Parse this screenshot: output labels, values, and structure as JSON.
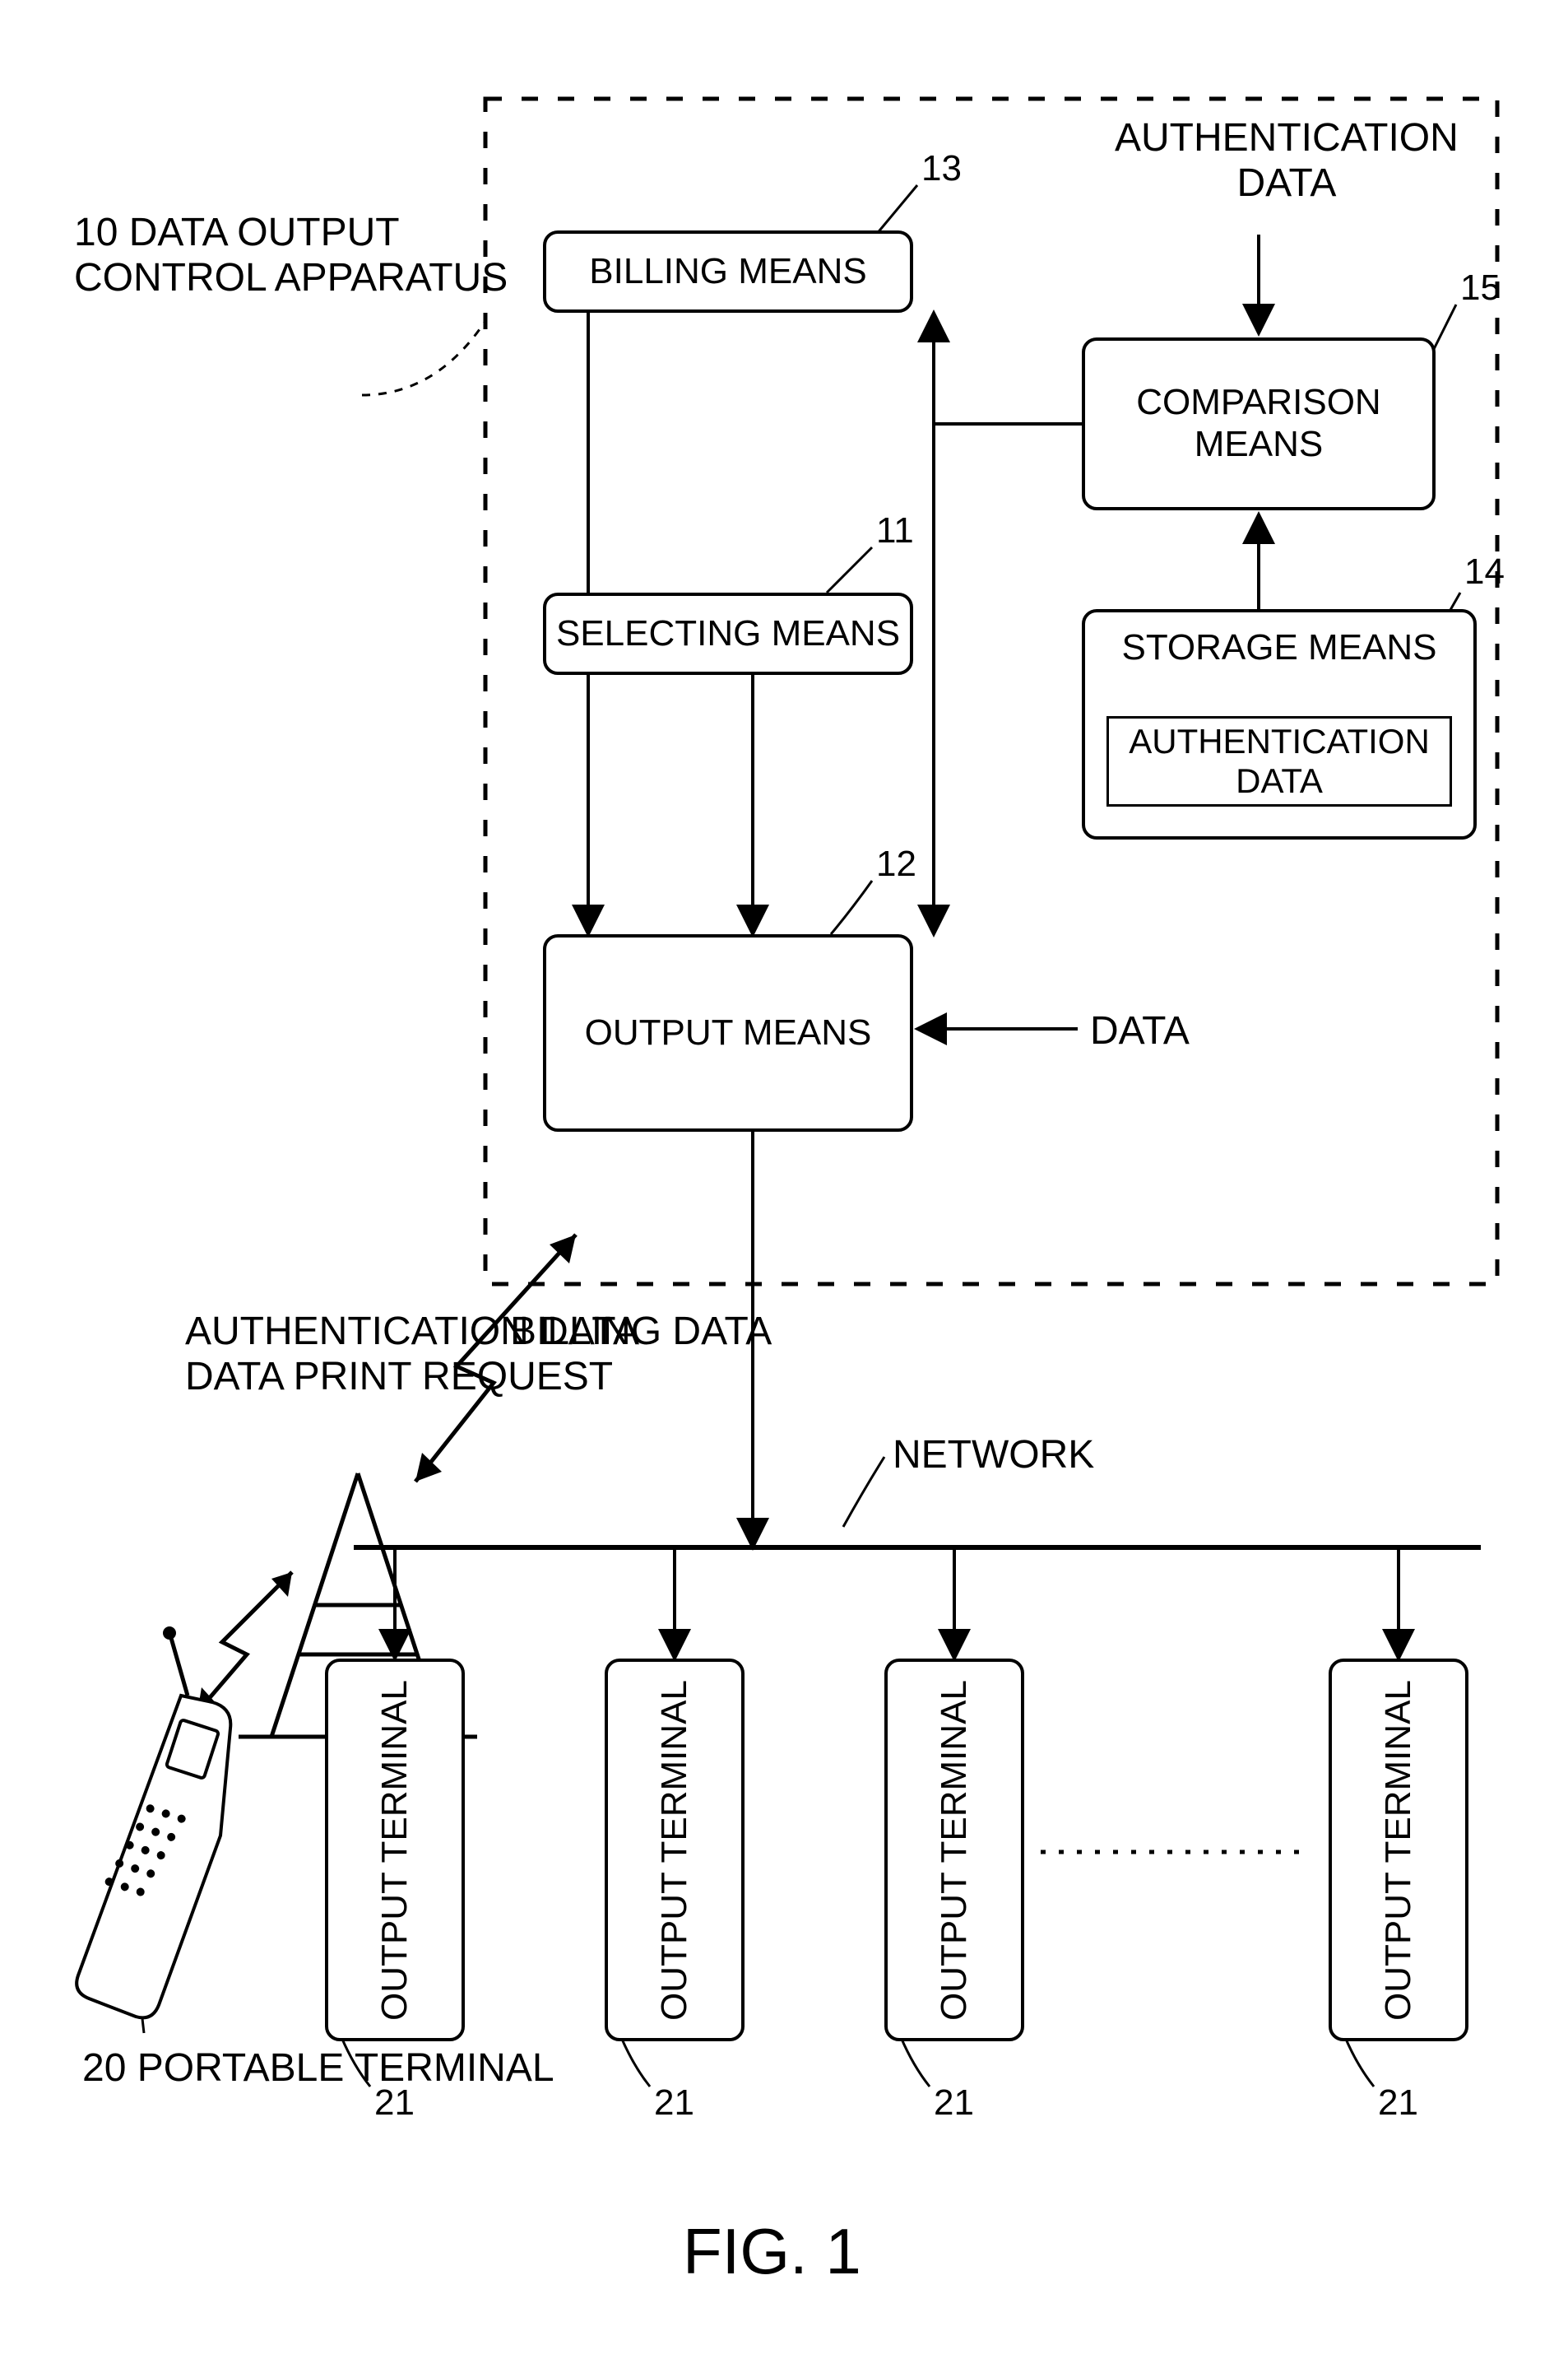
{
  "title": "10 DATA OUTPUT\nCONTROL APPARATUS",
  "boxes": {
    "billing": "BILLING MEANS",
    "selecting": "SELECTING MEANS",
    "output": "OUTPUT MEANS",
    "comparison": "COMPARISON\nMEANS",
    "storage": "STORAGE MEANS",
    "auth_inner": "AUTHENTICATION DATA",
    "ot": "OUTPUT TERMINAL"
  },
  "refs": {
    "r11": "11",
    "r12": "12",
    "r13": "13",
    "r14": "14",
    "r15": "15",
    "r20": "20",
    "r21": "21"
  },
  "labels": {
    "auth_data_top": "AUTHENTICATION\nDATA",
    "data": "DATA",
    "billing_data": "BILLING DATA",
    "auth_req": "AUTHENTICATION DATA\nDATA PRINT REQUEST",
    "portable_terminal": "PORTABLE TERMINAL",
    "network": "NETWORK"
  },
  "figure": "FIG. 1"
}
